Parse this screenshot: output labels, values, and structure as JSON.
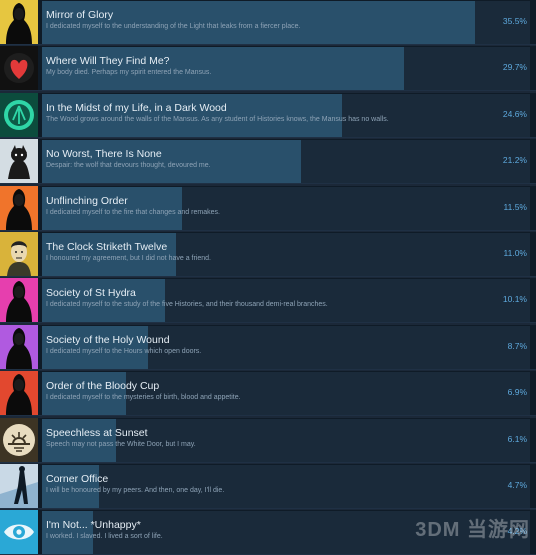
{
  "achievements": [
    {
      "title": "Mirror of Glory",
      "description": "I dedicated myself to the understanding of the Light that leaks from a fiercer place.",
      "percent": "35.5%",
      "percent_value": 35.5,
      "icon": "hooded-figure-icon",
      "icon_color": "#e6c640"
    },
    {
      "title": "Where Will They Find Me?",
      "description": "My body died. Perhaps my spirit entered the Mansus.",
      "percent": "29.7%",
      "percent_value": 29.7,
      "icon": "heart-icon",
      "icon_color": "#e33a3a"
    },
    {
      "title": "In the Midst of my Life, in a Dark Wood",
      "description": "The Wood grows around the walls of the Mansus. As any student of Histories knows, the Mansus has no walls.",
      "percent": "24.6%",
      "percent_value": 24.6,
      "icon": "tree-sigil-icon",
      "icon_color": "#2fd6a7"
    },
    {
      "title": "No Worst, There Is None",
      "description": "Despair: the wolf that devours thought, devoured me.",
      "percent": "21.2%",
      "percent_value": 21.2,
      "icon": "wolf-shadow-icon",
      "icon_color": "#d4dde3"
    },
    {
      "title": "Unflinching Order",
      "description": "I dedicated myself to the fire that changes and remakes.",
      "percent": "11.5%",
      "percent_value": 11.5,
      "icon": "hooded-figure-icon",
      "icon_color": "#f0742b"
    },
    {
      "title": "The Clock Striketh Twelve",
      "description": "I honoured my agreement, but I did not have a friend.",
      "percent": "11.0%",
      "percent_value": 11.0,
      "icon": "portrait-icon",
      "icon_color": "#d9b33a"
    },
    {
      "title": "Society of St Hydra",
      "description": "I dedicated myself to the study of the five Histories, and their thousand demi-real branches.",
      "percent": "10.1%",
      "percent_value": 10.1,
      "icon": "hooded-figure-icon",
      "icon_color": "#e63fae"
    },
    {
      "title": "Society of the Holy Wound",
      "description": "I dedicated myself to the Hours which open doors.",
      "percent": "8.7%",
      "percent_value": 8.7,
      "icon": "hooded-figure-icon",
      "icon_color": "#b05ae0"
    },
    {
      "title": "Order of the Bloody Cup",
      "description": "I dedicated myself to the mysteries of birth, blood and appetite.",
      "percent": "6.9%",
      "percent_value": 6.9,
      "icon": "hooded-figure-icon",
      "icon_color": "#e2482f"
    },
    {
      "title": "Speechless at Sunset",
      "description": "Speech may not pass the White Door, but I may.",
      "percent": "6.1%",
      "percent_value": 6.1,
      "icon": "sunset-sigil-icon",
      "icon_color": "#e8dcc0"
    },
    {
      "title": "Corner Office",
      "description": "I will be honoured by my peers. And then, one day, I'll die.",
      "percent": "4.7%",
      "percent_value": 4.7,
      "icon": "office-figure-icon",
      "icon_color": "#8fb3cf"
    },
    {
      "title": "I'm Not... *Unhappy*",
      "description": "I worked. I slaved. I lived a sort of life.",
      "percent": "4.2%",
      "percent_value": 4.2,
      "icon": "eye-icon",
      "icon_color": "#2aa8d6"
    }
  ],
  "watermark": "3DM 当游网"
}
